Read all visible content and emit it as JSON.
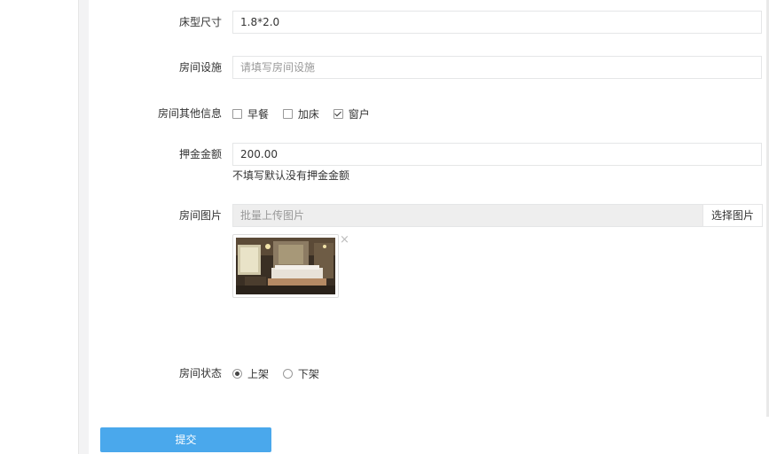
{
  "form": {
    "bed_size": {
      "label": "床型尺寸",
      "value": "1.8*2.0"
    },
    "facilities": {
      "label": "房间设施",
      "placeholder": "请填写房间设施"
    },
    "other_info": {
      "label": "房间其他信息",
      "options": [
        {
          "label": "早餐",
          "checked": false
        },
        {
          "label": "加床",
          "checked": false
        },
        {
          "label": "窗户",
          "checked": true
        }
      ]
    },
    "deposit": {
      "label": "押金金额",
      "value": "200.00",
      "help": "不填写默认没有押金金额"
    },
    "images": {
      "label": "房间图片",
      "placeholder": "批量上传图片",
      "pick_button": "选择图片",
      "remove_icon": "×",
      "thumbnail_icon": "hotel-room-photo"
    },
    "status": {
      "label": "房间状态",
      "options": [
        {
          "label": "上架",
          "checked": true
        },
        {
          "label": "下架",
          "checked": false
        }
      ]
    },
    "submit_label": "提交"
  },
  "colors": {
    "submit_bg": "#4aa8ec",
    "gutter": "#f3f3f4",
    "input_border": "#e5e6e7",
    "disabled_bg": "#eeeeee"
  }
}
